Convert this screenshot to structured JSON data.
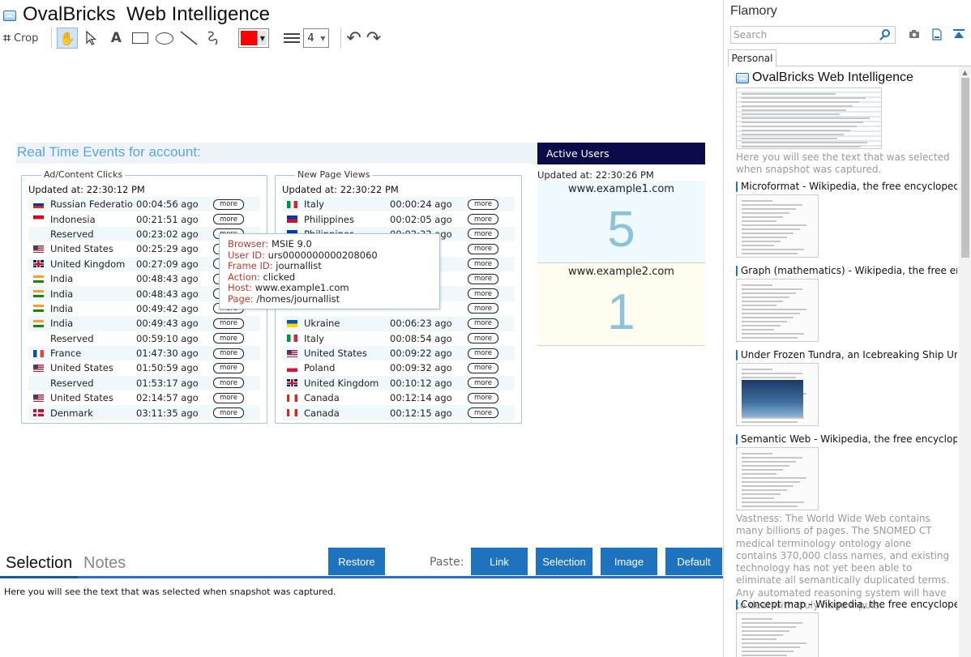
{
  "editor": {
    "title": "OvalBricks  Web Intelligence",
    "toolbar": {
      "crop_label": "Crop",
      "text_tool": "A",
      "color": "#ff0000",
      "line_width": "4"
    }
  },
  "snapshot": {
    "title": "Real Time Events for account:",
    "ad_clicks": {
      "legend": "Ad/Content Clicks",
      "updated": "Updated at: 22:30:12 PM",
      "rows": [
        {
          "flag": "ru",
          "country": "Russian Federatio",
          "time": "00:04:56 ago"
        },
        {
          "flag": "id",
          "country": "Indonesia",
          "time": "00:21:51 ago"
        },
        {
          "flag": "none",
          "country": "Reserved",
          "time": "00:23:02 ago"
        },
        {
          "flag": "us",
          "country": "United States",
          "time": "00:25:29 ago"
        },
        {
          "flag": "gb",
          "country": "United Kingdom",
          "time": "00:27:09 ago"
        },
        {
          "flag": "in",
          "country": "India",
          "time": "00:48:43 ago"
        },
        {
          "flag": "in",
          "country": "India",
          "time": "00:48:43 ago"
        },
        {
          "flag": "in",
          "country": "India",
          "time": "00:49:42 ago"
        },
        {
          "flag": "in",
          "country": "India",
          "time": "00:49:43 ago"
        },
        {
          "flag": "none",
          "country": "Reserved",
          "time": "00:59:10 ago"
        },
        {
          "flag": "fr",
          "country": "France",
          "time": "01:47:30 ago"
        },
        {
          "flag": "us",
          "country": "United States",
          "time": "01:50:59 ago"
        },
        {
          "flag": "none",
          "country": "Reserved",
          "time": "01:53:17 ago"
        },
        {
          "flag": "us",
          "country": "United States",
          "time": "02:14:57 ago"
        },
        {
          "flag": "dk",
          "country": "Denmark",
          "time": "03:11:35 ago"
        }
      ]
    },
    "page_views": {
      "legend": "New Page Views",
      "updated": "Updated at: 22:30:22 PM",
      "rows": [
        {
          "flag": "it",
          "country": "Italy",
          "time": "00:00:24 ago"
        },
        {
          "flag": "ph",
          "country": "Philippines",
          "time": "00:02:05 ago"
        },
        {
          "flag": "ph",
          "country": "Philippines",
          "time": "00:02:32 ago"
        },
        {
          "flag": "none",
          "country": "",
          "time": ""
        },
        {
          "flag": "none",
          "country": "",
          "time": ""
        },
        {
          "flag": "none",
          "country": "",
          "time": ""
        },
        {
          "flag": "none",
          "country": "",
          "time": ""
        },
        {
          "flag": "none",
          "country": "",
          "time": ""
        },
        {
          "flag": "ua",
          "country": "Ukraine",
          "time": "00:06:23 ago"
        },
        {
          "flag": "it",
          "country": "Italy",
          "time": "00:08:54 ago"
        },
        {
          "flag": "us",
          "country": "United States",
          "time": "00:09:22 ago"
        },
        {
          "flag": "pl",
          "country": "Poland",
          "time": "00:09:32 ago"
        },
        {
          "flag": "gb",
          "country": "United Kingdom",
          "time": "00:10:12 ago"
        },
        {
          "flag": "ca",
          "country": "Canada",
          "time": "00:12:14 ago"
        },
        {
          "flag": "ca",
          "country": "Canada",
          "time": "00:12:15 ago"
        }
      ]
    },
    "more_label": "more",
    "tooltip": {
      "browser_k": "Browser:",
      "browser_v": "MSIE 9.0",
      "user_k": "User ID:",
      "user_v": "urs0000000000208060",
      "frame_k": "Frame ID:",
      "frame_v": "journallist",
      "action_k": "Action:",
      "action_v": "clicked",
      "host_k": "Host:",
      "host_v": "www.example1.com",
      "page_k": "Page:",
      "page_v": "/homes/journallist"
    },
    "active_users": {
      "header": "Active Users",
      "updated": "Updated at: 22:30:26 PM",
      "cards": [
        {
          "host": "www.example1.com",
          "count": "5",
          "bg": "#eefaff"
        },
        {
          "host": "www.example2.com",
          "count": "1",
          "bg": "#fffdf0"
        }
      ]
    }
  },
  "bottom": {
    "tab_selection": "Selection",
    "tab_notes": "Notes",
    "restore": "Restore",
    "paste_label": "Paste:",
    "paste_link": "Link",
    "paste_selection": "Selection",
    "paste_image": "Image",
    "paste_default": "Default",
    "selection_text": "Here you will see the text that was selected when snapshot was captured."
  },
  "sidebar": {
    "title": "Flamory",
    "search_placeholder": "Search",
    "tab_personal": "Personal",
    "entries": [
      {
        "title": "OvalBricks  Web Intelligence",
        "desc": "Here you will see the text that was selected when snapshot was captured."
      },
      {
        "title": "Microformat - Wikipedia, the free encyclopedia",
        "desc": ""
      },
      {
        "title": "Graph (mathematics) - Wikipedia, the free encyclopedia",
        "desc": ""
      },
      {
        "title": "Under Frozen Tundra, an Icebreaking Ship Uncovers",
        "desc": ""
      },
      {
        "title": "Semantic Web - Wikipedia, the free encyclopedia",
        "desc": "Vastness: The World Wide Web contains many billions of pages. The SNOMED CT medical terminology ontology alone contains 370,000 class names, and existing technology has not yet been able to eliminate all semantically duplicated terms. Any automated reasoning system will have to deal with truly huge inputs."
      },
      {
        "title": "Concept map - Wikipedia, the free encyclopedia",
        "desc": ""
      }
    ]
  }
}
